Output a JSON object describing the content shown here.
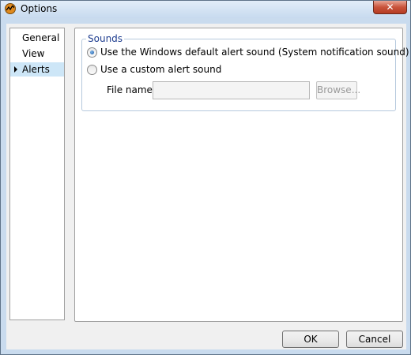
{
  "window": {
    "title": "Options",
    "close_glyph": "✕"
  },
  "nav": {
    "items": [
      {
        "label": "General",
        "selected": false
      },
      {
        "label": "View",
        "selected": false
      },
      {
        "label": "Alerts",
        "selected": true
      }
    ]
  },
  "sounds": {
    "group_title": "Sounds",
    "option_default": "Use the Windows default alert sound (System notification sound)",
    "option_custom": "Use a custom alert sound",
    "selected_option": "default",
    "file_name_label": "File name",
    "file_name_value": "",
    "browse_label": "Browse..."
  },
  "footer": {
    "ok_label": "OK",
    "cancel_label": "Cancel"
  },
  "icons": {
    "app": "app-logo-icon",
    "close": "close-icon",
    "arrow": "selected-arrow-icon"
  },
  "colors": {
    "selection": "#cde6f7",
    "group_title": "#1e3d8f",
    "close_button": "#c9543c"
  }
}
